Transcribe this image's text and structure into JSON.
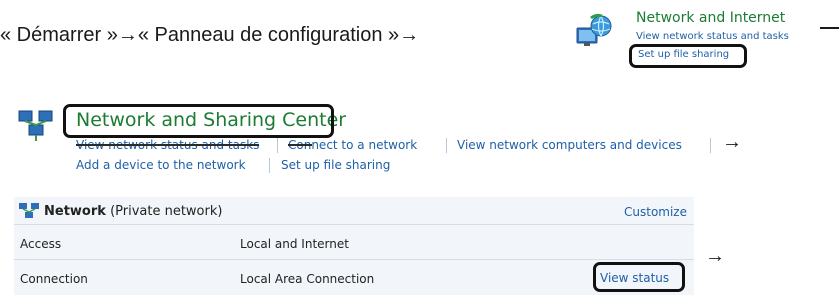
{
  "instruction": {
    "text": "« Démarrer »→« Panneau de configuration »→",
    "arrow": "→"
  },
  "control_panel": {
    "category_title": "Network and Internet",
    "links": [
      "View network status and tasks",
      "Set up file sharing"
    ],
    "icon": "network-globe-icon"
  },
  "sharing_center": {
    "title": "Network and Sharing Center",
    "icon": "network-computers-icon",
    "row1": [
      "View network status and tasks",
      "Connect to a network",
      "View network computers and devices"
    ],
    "row2": [
      "Add a device to the network",
      "Set up file sharing"
    ]
  },
  "network_panel": {
    "name": "Network",
    "type": "(Private network)",
    "customize": "Customize",
    "icon": "network-computers-icon",
    "rows": [
      {
        "label": "Access",
        "value": "Local and Internet"
      },
      {
        "label": "Connection",
        "value": "Local Area Connection",
        "action": "View status"
      }
    ]
  },
  "colors": {
    "link": "#1f5fa8",
    "title_green": "#1c7c33",
    "callout": "#111111"
  }
}
